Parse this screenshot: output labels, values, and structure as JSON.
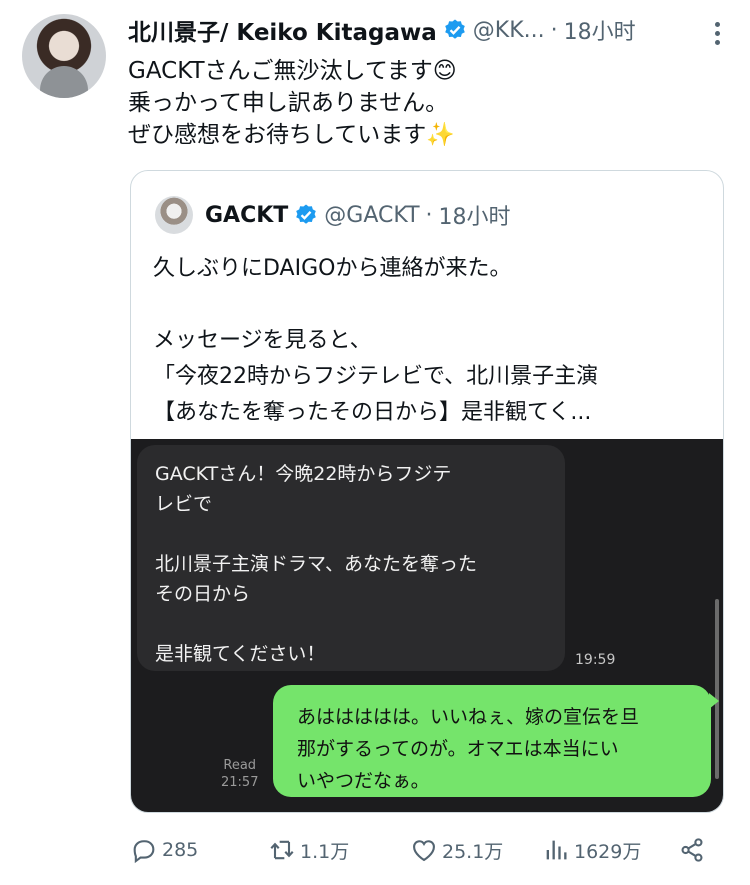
{
  "tweet": {
    "author_name": "北川景子/ Keiko Kitagawa",
    "handle": "@KK...",
    "separator": "·",
    "time": "18小时",
    "text_lines": [
      "GACKTさんご無沙汰してます😊",
      "乗っかって申し訳ありません。",
      "ぜひ感想をお待ちしています✨"
    ]
  },
  "quote": {
    "author_name": "GACKT",
    "handle": "@GACKT",
    "separator": "·",
    "time": "18小时",
    "text_lines": [
      "久しぶりにDAIGOから連絡が来た。",
      "",
      "メッセージを見ると、",
      "「今夜22時からフジテレビで、北川景子主演",
      "【あなたを奪ったその日から】是非観てく..."
    ],
    "chat": {
      "left_lines": [
        "GACKTさん！今晩22時からフジテ",
        "レビで",
        "",
        "北川景子主演ドラマ、あなたを奪った",
        "その日から",
        "",
        "是非観てください！"
      ],
      "left_time": "19:59",
      "right_lines": [
        "あははははは。いいねぇ、嫁の宣伝を旦",
        "那がするってのが。オマエは本当にい",
        "いやつだなぁ。"
      ],
      "read_label": "Read",
      "read_time": "21:57"
    }
  },
  "actions": {
    "reply_count": "285",
    "retweet_count": "1.1万",
    "like_count": "25.1万",
    "views_count": "1629万"
  },
  "colors": {
    "verified": "#1d9bf0",
    "secondary_text": "#536471",
    "chat_background": "#1c1c1e",
    "left_bubble": "#2b2b2d",
    "right_bubble": "#75e46b"
  }
}
